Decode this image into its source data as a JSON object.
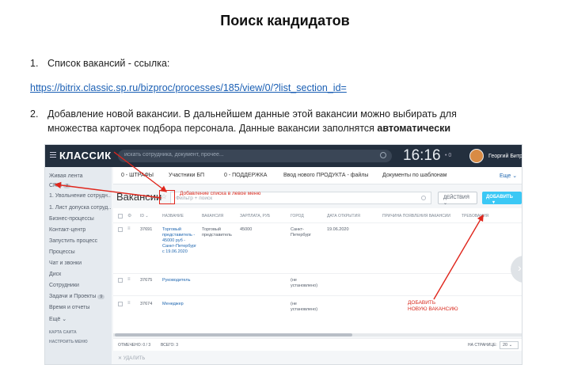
{
  "document": {
    "title": "Поиск кандидатов",
    "item1_num": "1.",
    "item1_text": "Список вакансий - ссылка:",
    "link": "https://bitrix.classic.sp.ru/bizproc/processes/185/view/0/?list_section_id=",
    "item2_num": "2.",
    "item2_line1": "Добавление новой вакансии. В дальнейшем данные этой вакансии можно выбирать для",
    "item2_line2_prefix": "множества карточек подбора персонала. Данные вакансии заполнятся",
    "item2_bold": "автоматически"
  },
  "topbar": {
    "logo": "КЛАССИК",
    "search_placeholder": "искать сотрудника, документ, прочее...",
    "clock": "16:16",
    "notifications": "• 0",
    "user": "Георгий Битрикс ⌄"
  },
  "sidebar": {
    "items": [
      "Живая лента",
      "CRM",
      "1. Увольнение сотрудн...",
      "1. Лист допуска сотруд...",
      "Бизнес-процессы",
      "Контакт-центр",
      "Запустить процесс",
      "Процессы",
      "Чат и звонки",
      "Диск",
      "Сотрудники",
      "Задачи и Проекты",
      "Время и отчеты",
      "Ещё ⌄"
    ],
    "crm_badge": "3",
    "tasks_badge": "9",
    "small_items": [
      "КАРТА САЙТА",
      "НАСТРОИТЬ МЕНЮ"
    ]
  },
  "tabs": [
    "0 - ШТРАФЫ",
    "Участники БП",
    "0 - ПОДДЕРЖКА",
    "Ввод нового ПРОДУКТА - файлы",
    "Документы по шаблонам",
    "Еще ⌄"
  ],
  "list": {
    "heading": "Вакансии",
    "star": "☆",
    "filter_placeholder": "Фильтр + поиск",
    "actions_label": "ДЕЙСТВИЯ ⌄",
    "add_label": "ДОБАВИТЬ",
    "add_arrow": "▾"
  },
  "table": {
    "columns": [
      "ID ⌄",
      "НАЗВАНИЕ",
      "ВАКАНСИЯ",
      "ЗАРПЛАТА, РУБ",
      "ГОРОД",
      "ДАТА ОТКРЫТИЯ",
      "ПРИЧИНА ПОЯВЛЕНИЯ ВАКАНСИИ",
      "ТРЕБОВАНИЯ"
    ],
    "rows": [
      {
        "id": "37691",
        "name": "Торговый представитель - 45000 руб - Санкт-Петербург с 19.06.2020",
        "vacancy": "Торговый представитель",
        "salary": "45000",
        "city": "Санкт-Петербург",
        "date": "19.06.2020"
      },
      {
        "id": "37675",
        "name": "Руководитель",
        "vacancy": "",
        "salary": "",
        "city": "(не установлено)",
        "date": ""
      },
      {
        "id": "37674",
        "name": "Менеджер",
        "vacancy": "",
        "salary": "",
        "city": "(не установлено)",
        "date": ""
      }
    ]
  },
  "footer": {
    "marked": "ОТМЕЧЕНО: 0 / 3",
    "total": "ВСЕГО: 3",
    "per_page_label": "НА СТРАНИЦЕ:",
    "per_page": "20 ⌄",
    "delete": "✕ УДАЛИТЬ"
  },
  "annotations": {
    "add_to_menu": "Добавление списка в левое меню",
    "add_vacancy_line1": "ДОБАВИТЬ",
    "add_vacancy_line2": "НОВУЮ ВАКАНСИЮ"
  },
  "colors": {
    "accent": "#3bc8f5",
    "annotation": "#e0261c",
    "topbar": "#232f3e",
    "link": "#1a5fb4"
  }
}
